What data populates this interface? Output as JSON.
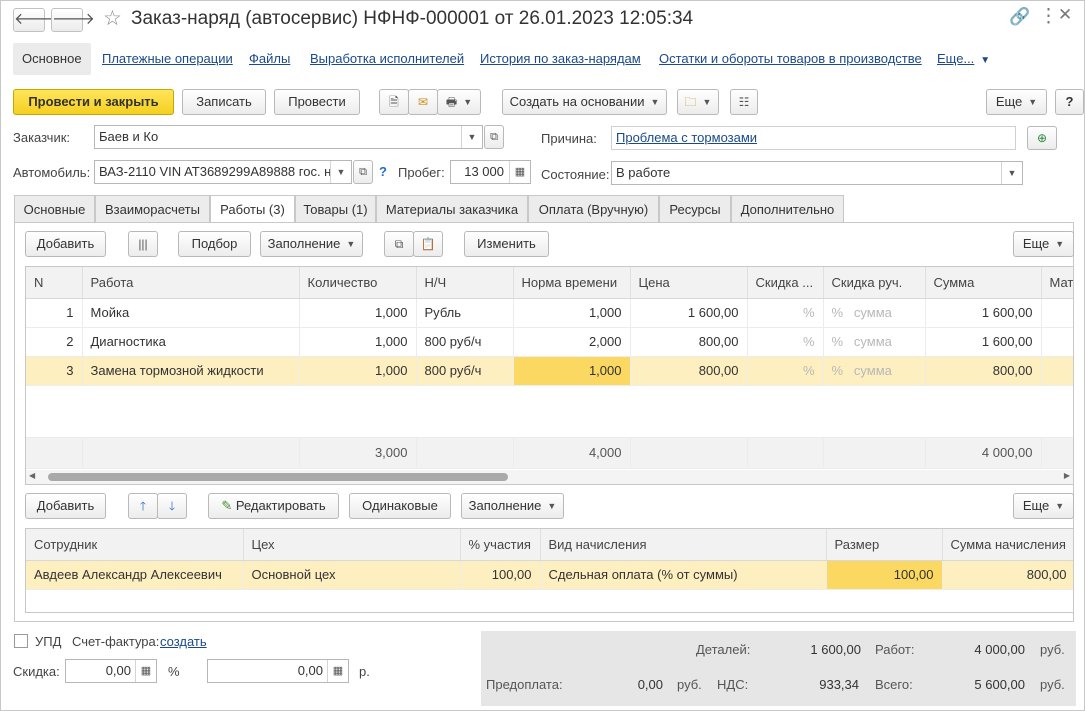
{
  "window": {
    "title": "Заказ-наряд (автосервис) НФНФ-000001 от 26.01.2023 12:05:34"
  },
  "sections": {
    "active": "Основное",
    "links": [
      "Платежные операции",
      "Файлы",
      "Выработка исполнителей",
      "История по заказ-нарядам",
      "Остатки и обороты товаров в производстве",
      "Еще..."
    ]
  },
  "toolbar": {
    "post_close": "Провести и закрыть",
    "save": "Записать",
    "post": "Провести",
    "create_based": "Создать на основании",
    "more": "Еще",
    "help": "?"
  },
  "header": {
    "customer_label": "Заказчик:",
    "customer": "Баев и Ко",
    "reason_label": "Причина:",
    "reason": "Проблема с тормозами",
    "car_label": "Автомобиль:",
    "car": "ВАЗ-2110 VIN AT3689299A89888 гос. н",
    "car_help": "?",
    "mileage_label": "Пробег:",
    "mileage": "13 000",
    "state_label": "Состояние:",
    "state": "В работе"
  },
  "tabs": [
    "Основные",
    "Взаиморасчеты",
    "Работы (3)",
    "Товары (1)",
    "Материалы заказчика",
    "Оплата (Вручную)",
    "Ресурсы",
    "Дополнительно"
  ],
  "works_toolbar": {
    "add": "Добавить",
    "pick": "Подбор",
    "fill": "Заполнение",
    "change": "Изменить",
    "more": "Еще"
  },
  "works": {
    "columns": [
      "N",
      "Работа",
      "Количество",
      "Н/Ч",
      "Норма времени",
      "Цена",
      "Скидка ...",
      "Скидка руч.",
      "Сумма",
      "Мат"
    ],
    "rows": [
      {
        "n": "1",
        "work": "Мойка",
        "qty": "1,000",
        "nh": "Рубль",
        "norm": "1,000",
        "price": "1 600,00",
        "d1": "%",
        "d2": "%",
        "d3": "сумма",
        "sum": "1 600,00"
      },
      {
        "n": "2",
        "work": "Диагностика",
        "qty": "1,000",
        "nh": "800 руб/ч",
        "norm": "2,000",
        "price": "800,00",
        "d1": "%",
        "d2": "%",
        "d3": "сумма",
        "sum": "1 600,00"
      },
      {
        "n": "3",
        "work": "Замена тормозной жидкости",
        "qty": "1,000",
        "nh": "800 руб/ч",
        "norm": "1,000",
        "price": "800,00",
        "d1": "%",
        "d2": "%",
        "d3": "сумма",
        "sum": "800,00"
      }
    ],
    "totals": {
      "qty": "3,000",
      "norm": "4,000",
      "sum": "4 000,00"
    }
  },
  "exec_toolbar": {
    "add": "Добавить",
    "edit": "Редактировать",
    "same": "Одинаковые",
    "fill": "Заполнение",
    "more": "Еще"
  },
  "executors": {
    "columns": [
      "Сотрудник",
      "Цех",
      "% участия",
      "Вид начисления",
      "Размер",
      "Сумма начисления"
    ],
    "rows": [
      {
        "employee": "Авдеев Александр Алексеевич",
        "shop": "Основной цех",
        "pct": "100,00",
        "kind": "Сдельная оплата (% от суммы)",
        "size": "100,00",
        "sum": "800,00"
      }
    ]
  },
  "footer": {
    "upd_label": "УПД",
    "invoice_label": "Счет-фактура:",
    "invoice_link": "создать",
    "discount_label": "Скидка:",
    "discount_pct": "0,00",
    "pct_sign": "%",
    "discount_sum": "0,00",
    "rub_short": "р."
  },
  "summary": {
    "parts_label": "Деталей:",
    "parts": "1 600,00",
    "works_label": "Работ:",
    "works": "4 000,00",
    "prepay_label": "Предоплата:",
    "prepay": "0,00",
    "vat_label": "НДС:",
    "vat": "933,34",
    "total_label": "Всего:",
    "total": "5 600,00",
    "rub": "руб."
  }
}
